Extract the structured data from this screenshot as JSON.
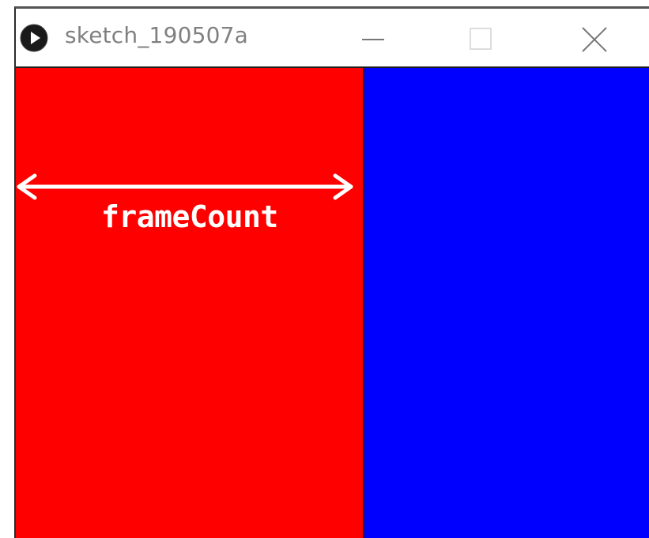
{
  "window": {
    "title": "sketch_190507a",
    "app_icon": "processing-play-icon",
    "controls": {
      "minimize": "minimize-icon",
      "maximize": "maximize-icon",
      "close": "close-icon"
    }
  },
  "canvas": {
    "left_color": "#ff0000",
    "right_color": "#0000ff",
    "annotation": {
      "label": "frameCount",
      "icon": "double-arrow-icon",
      "color": "#ffffff"
    }
  }
}
